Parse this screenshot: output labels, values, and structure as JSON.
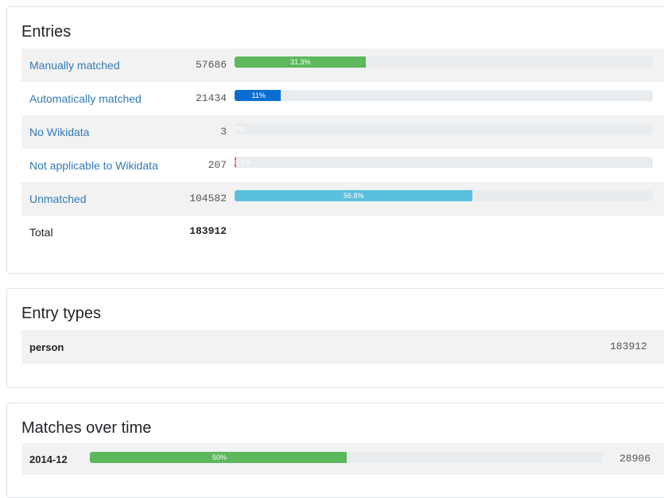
{
  "entries": {
    "title": "Entries",
    "rows": [
      {
        "label": "Manually matched",
        "count": "57686",
        "percent_label": "31.3%",
        "fraction": 0.313,
        "color": "#5cb85c"
      },
      {
        "label": "Automatically matched",
        "count": "21434",
        "percent_label": "11%",
        "fraction": 0.11,
        "color": "#0a6ed1"
      },
      {
        "label": "No Wikidata",
        "count": "3",
        "percent_label": "0%",
        "fraction": 0.0,
        "color": "#e9ecef"
      },
      {
        "label": "Not applicable to Wikidata",
        "count": "207",
        "percent_label": "0.1%",
        "fraction": 0.001,
        "color": "#d9534f"
      },
      {
        "label": "Unmatched",
        "count": "104582",
        "percent_label": "56.8%",
        "fraction": 0.568,
        "color": "#5bc0de"
      }
    ],
    "total_label": "Total",
    "total_count": "183912"
  },
  "entry_types": {
    "title": "Entry types",
    "rows": [
      {
        "label": "person",
        "count": "183912"
      }
    ]
  },
  "matches_over_time": {
    "title": "Matches over time",
    "rows": [
      {
        "label": "2014-12",
        "percent_label": "50%",
        "fraction": 0.5,
        "count": "28906",
        "color": "#5cb85c"
      }
    ]
  }
}
